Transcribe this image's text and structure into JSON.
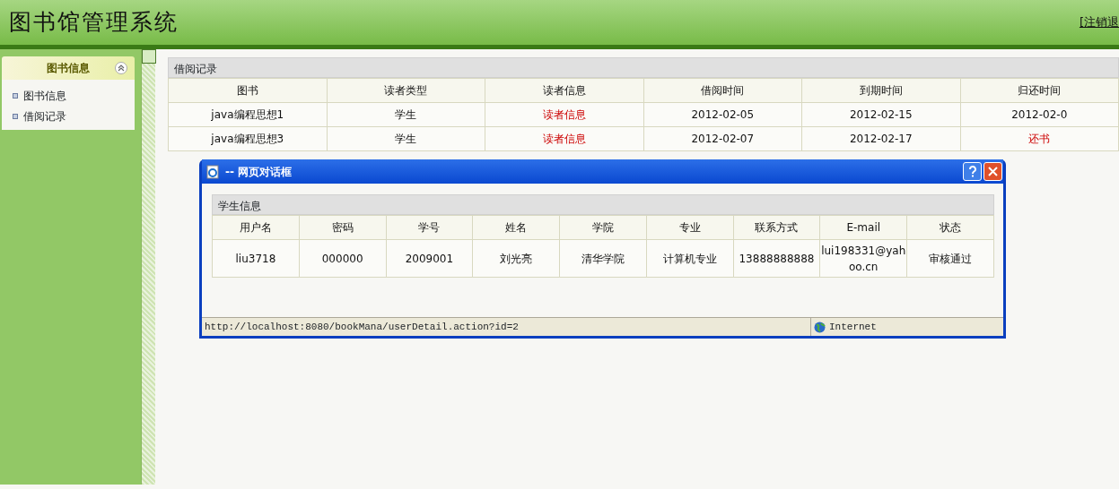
{
  "header": {
    "title": "图书馆管理系统",
    "logout_link": "[注销退"
  },
  "sidebar": {
    "panel_title": "图书信息",
    "items": [
      {
        "label": "图书信息"
      },
      {
        "label": "借阅记录"
      }
    ]
  },
  "borrow_table": {
    "title": "借阅记录",
    "columns": [
      "图书",
      "读者类型",
      "读者信息",
      "借阅时间",
      "到期时间",
      "归还时间"
    ],
    "rows": [
      {
        "book": "java编程思想1",
        "reader_type": "学生",
        "reader_info": "读者信息",
        "borrow_time": "2012-02-05",
        "due_time": "2012-02-15",
        "return": {
          "kind": "date",
          "text": "2012-02-0"
        }
      },
      {
        "book": "java编程思想3",
        "reader_type": "学生",
        "reader_info": "读者信息",
        "borrow_time": "2012-02-07",
        "due_time": "2012-02-17",
        "return": {
          "kind": "link",
          "text": "还书"
        }
      }
    ]
  },
  "dialog": {
    "title": "-- 网页对话框",
    "panel_title": "学生信息",
    "columns": [
      "用户名",
      "密码",
      "学号",
      "姓名",
      "学院",
      "专业",
      "联系方式",
      "E-mail",
      "状态"
    ],
    "rows": [
      [
        "liu3718",
        "000000",
        "2009001",
        "刘光亮",
        "清华学院",
        "计算机专业",
        "13888888888",
        "lui198331@yahoo.cn",
        "审核通过"
      ]
    ],
    "status_url": "http://localhost:8080/bookMana/userDetail.action?id=2",
    "zone": "Internet"
  }
}
